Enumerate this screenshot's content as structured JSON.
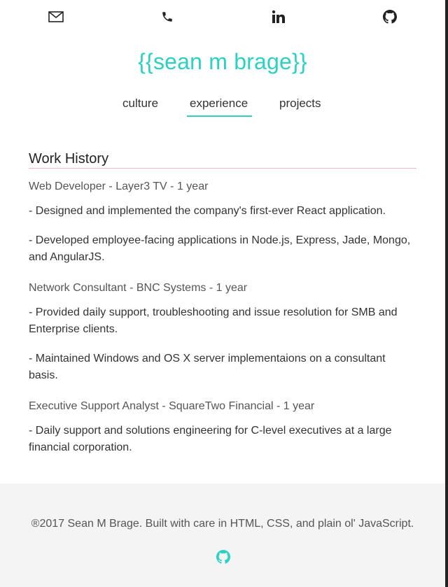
{
  "contact_icons": [
    "mail-icon",
    "phone-icon",
    "linkedin-icon",
    "github-icon"
  ],
  "brand": "{{sean m brage}}",
  "nav": {
    "tabs": [
      "culture",
      "experience",
      "projects"
    ],
    "active": "experience"
  },
  "section_title": "Work History",
  "jobs": [
    {
      "title": "Web Developer - Layer3 TV - 1 year",
      "bullets": [
        "- Designed and implemented the company's first-ever React application.",
        "- Developed employee-facing applications in Node.js, Express, Jade, Mongo, and AngularJS."
      ]
    },
    {
      "title": "Network Consultant - BNC Systems - 1 year",
      "bullets": [
        "- Provided daily support, troubleshooting and issue resolution for SMB and Enterprise clients.",
        "- Maintained Windows and OS X server implementaions on a consultant basis."
      ]
    },
    {
      "title": "Executive Support Analyst - SquareTwo Financial - 1 year",
      "bullets": [
        "- Daily support and solutions engineering for C-level executives at a large financial corporation."
      ]
    }
  ],
  "footer": {
    "text": "®2017 Sean M Brage. Built with care in HTML, CSS, and plain ol' JavaScript.",
    "icon": "github-icon"
  },
  "colors": {
    "accent": "#2bd1c3",
    "divider": "#f2b8c6",
    "footer_bg": "#f4f4f4"
  }
}
